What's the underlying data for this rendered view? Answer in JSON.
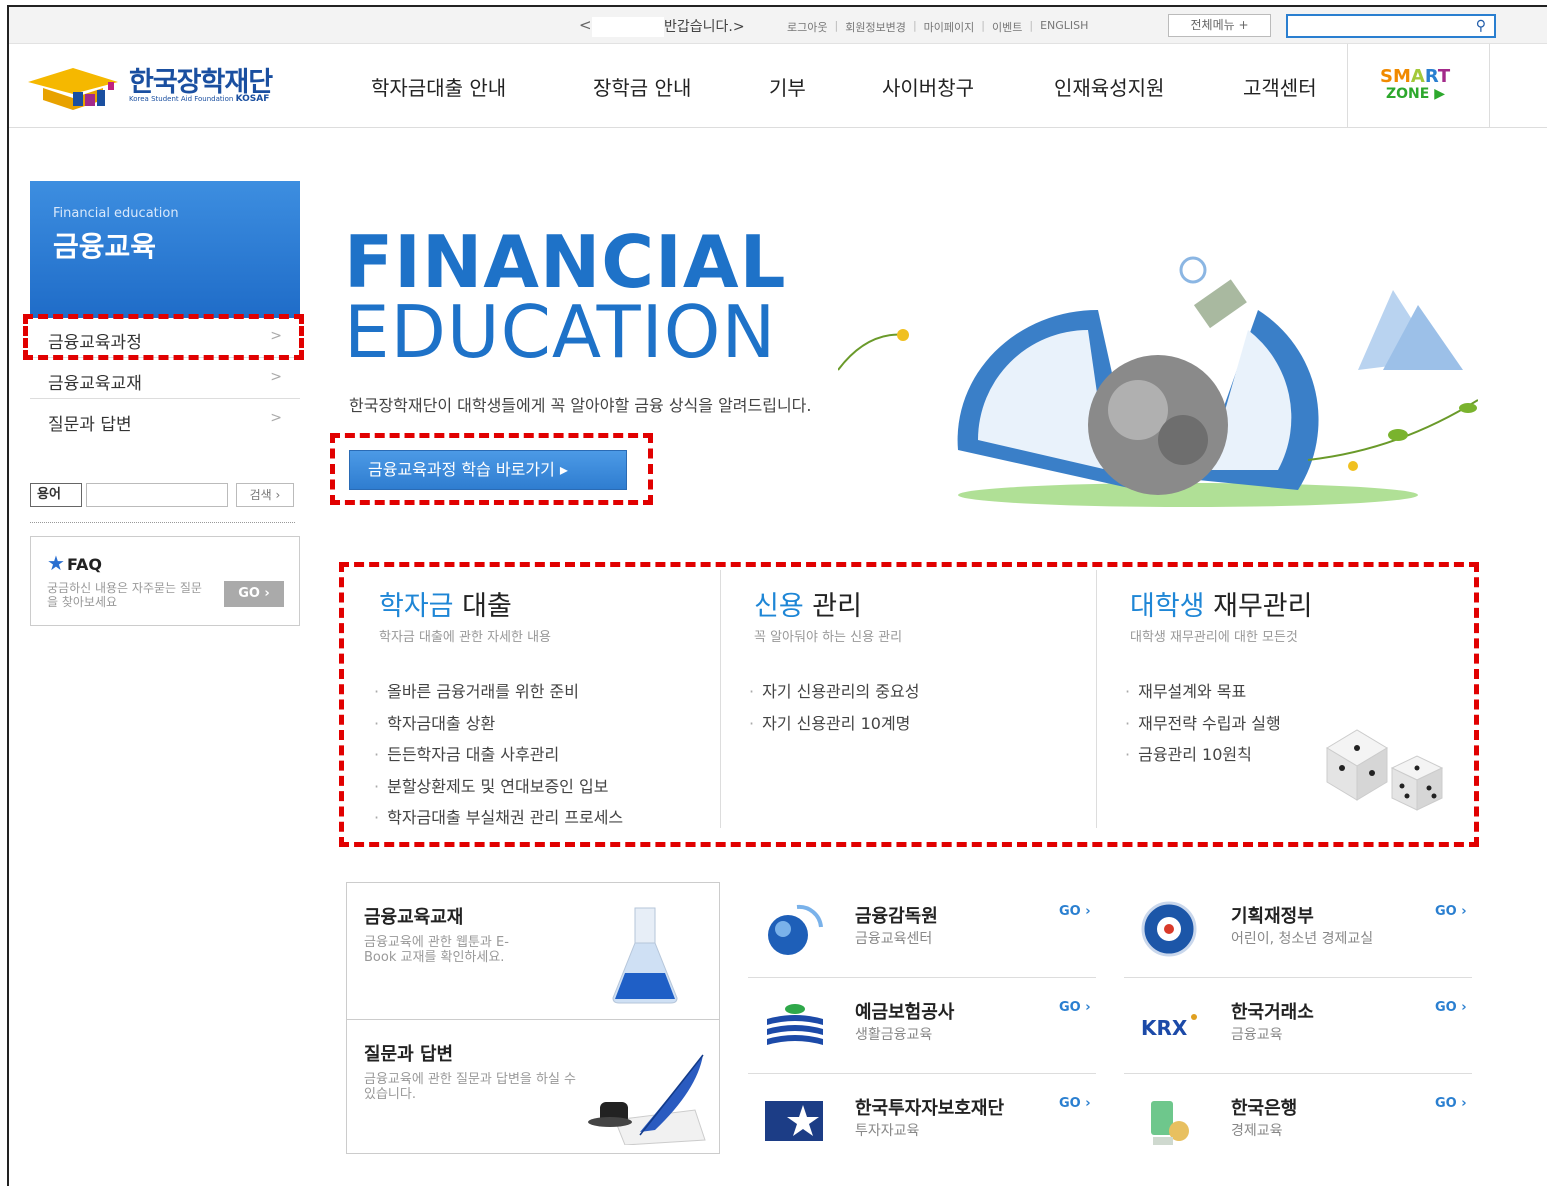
{
  "topbar": {
    "prev_arrow": "<",
    "greeting": "반갑습니다.>",
    "links": [
      "로그아웃",
      "회원정보변경",
      "마이페이지",
      "이벤트",
      "ENGLISH"
    ],
    "all_menu": "전체메뉴 +",
    "search_placeholder": ""
  },
  "logo": {
    "title": "한국장학재단",
    "subtitle": "Korea Student Aid Foundation",
    "abbr": "KOSAF"
  },
  "gnb": [
    "학자금대출 안내",
    "장학금 안내",
    "기부",
    "사이버창구",
    "인재육성지원",
    "고객센터"
  ],
  "smart": {
    "line1": "SMART",
    "line2": "ZONE"
  },
  "sidebar": {
    "title_en": "Financial education",
    "title": "금융교육",
    "items": [
      {
        "label": "금융교육과정"
      },
      {
        "label": "금융교육교재"
      },
      {
        "label": "질문과 답변"
      }
    ],
    "term_label": "용어",
    "term_button": "검색 ›",
    "faq_title": "FAQ",
    "faq_desc": "궁금하신 내용은 자주묻는 질문을 찾아보세요",
    "faq_go": "GO ›"
  },
  "hero": {
    "title1": "FINANCIAL",
    "title2": "EDUCATION",
    "desc": "한국장학재단이 대학생들에게 꼭 알아야할 금융 상식을 알려드립니다.",
    "button": "금융교육과정 학습 바로가기 ▸"
  },
  "columns": [
    {
      "head_blue": "학자금",
      "head_rest": " 대출",
      "sub": "학자금 대출에 관한 자세한 내용",
      "items": [
        "올바른 금융거래를 위한 준비",
        "학자금대출 상환",
        "든든학자금 대출 사후관리",
        "분할상환제도 및 연대보증인 입보",
        "학자금대출 부실채권 관리 프로세스"
      ]
    },
    {
      "head_blue": "신용",
      "head_rest": " 관리",
      "sub": "꼭 알아둬야 하는 신용 관리",
      "items": [
        "자기 신용관리의 중요성",
        "자기 신용관리 10계명"
      ]
    },
    {
      "head_blue": "대학생",
      "head_rest": " 재무관리",
      "sub": "대학생 재무관리에 대한 모든것",
      "items": [
        "재무설계와 목표",
        "재무전략 수립과 실행",
        "금융관리 10원칙"
      ]
    }
  ],
  "boxes": [
    {
      "title": "금융교육교재",
      "desc": "금융교육에 관한 웹툰과 E-Book 교재를 확인하세요."
    },
    {
      "title": "질문과 답변",
      "desc": "금융교육에 관한 질문과 답변을 하실 수 있습니다."
    }
  ],
  "orgs": [
    {
      "name": "금융감독원",
      "caption": "금융교육센터",
      "go": "GO ›",
      "icon": "fss-logo-icon"
    },
    {
      "name": "기획재정부",
      "caption": "어린이, 청소년 경제교실",
      "go": "GO ›",
      "icon": "mosf-logo-icon"
    },
    {
      "name": "예금보험공사",
      "caption": "생활금융교육",
      "go": "GO ›",
      "icon": "kdic-logo-icon"
    },
    {
      "name": "한국거래소",
      "caption": "금융교육",
      "go": "GO ›",
      "icon": "krx-logo-icon",
      "icon_text": "KRX"
    },
    {
      "name": "한국투자자보호재단",
      "caption": "투자자교육",
      "go": "GO ›",
      "icon": "kifin-logo-icon"
    },
    {
      "name": "한국은행",
      "caption": "경제교육",
      "go": "GO ›",
      "icon": "bok-logo-icon"
    }
  ],
  "colors": {
    "brand": "#1e72c8",
    "highlight": "#e10000",
    "accent": "#2a7fd0"
  }
}
